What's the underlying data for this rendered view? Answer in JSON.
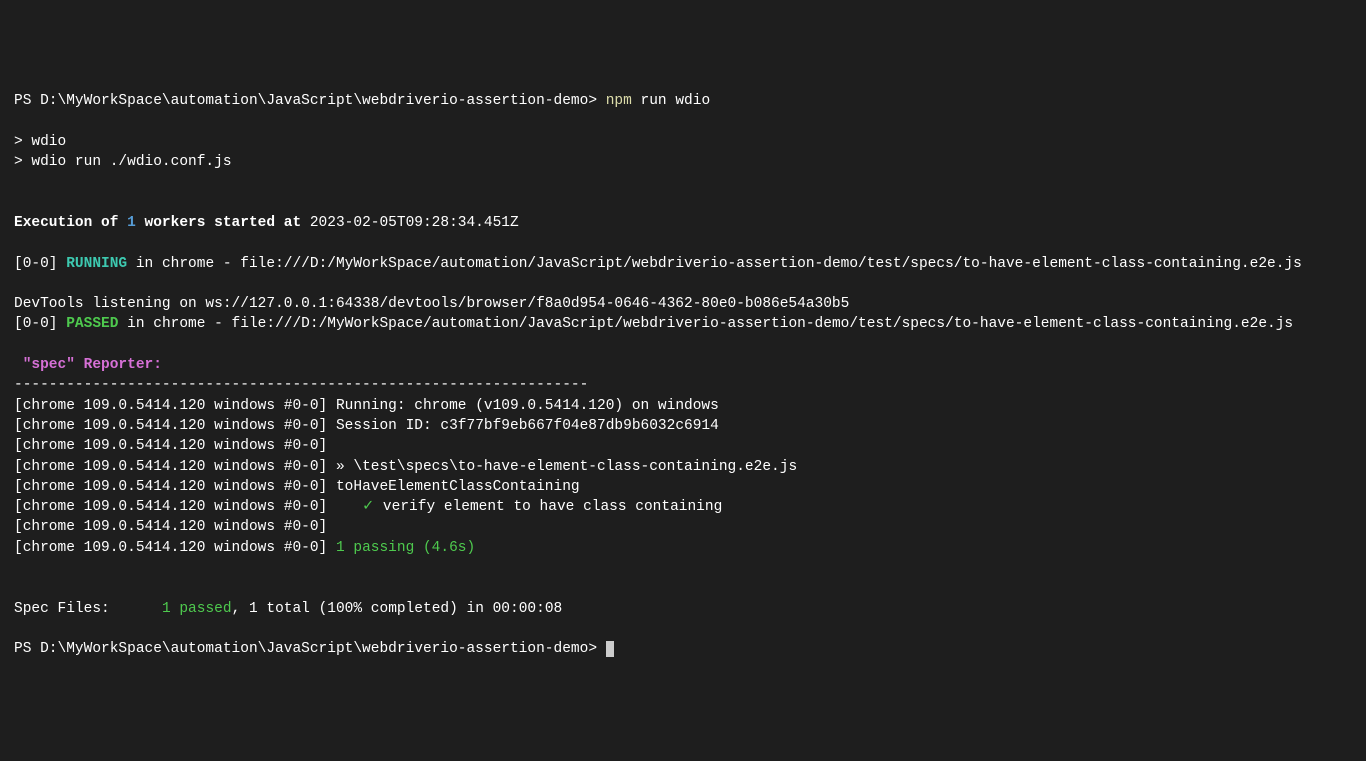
{
  "prompt": {
    "prefix": "PS ",
    "path": "D:\\MyWorkSpace\\automation\\JavaScript\\webdriverio-assertion-demo",
    "suffix": "> ",
    "command_npm": "npm",
    "command_rest": " run wdio"
  },
  "script_output": {
    "line1": "> wdio",
    "line2": "> wdio run ./wdio.conf.js"
  },
  "execution": {
    "prefix": "Execution of ",
    "workers": "1",
    "mid": " workers started at",
    "timestamp": " 2023-02-05T09:28:34.451Z"
  },
  "running": {
    "prefix": "[0-0] ",
    "status": "RUNNING",
    "suffix": " in chrome - file:///D:/MyWorkSpace/automation/JavaScript/webdriverio-assertion-demo/test/specs/to-have-element-class-containing.e2e.js"
  },
  "devtools": "DevTools listening on ws://127.0.0.1:64338/devtools/browser/f8a0d954-0646-4362-80e0-b086e54a30b5",
  "passed": {
    "prefix": "[0-0] ",
    "status": "PASSED",
    "suffix": " in chrome - file:///D:/MyWorkSpace/automation/JavaScript/webdriverio-assertion-demo/test/specs/to-have-element-class-containing.e2e.js"
  },
  "reporter": {
    "spec_quote": " \"spec\"",
    "reporter_label": " Reporter:"
  },
  "divider": "------------------------------------------------------------------",
  "chrome_prefix": "[chrome 109.0.5414.120 windows #0-0]",
  "lines": {
    "l1": " Running: chrome (v109.0.5414.120) on windows",
    "l2": " Session ID: c3f77bf9eb667f04e87db9b6032c6914",
    "l3": "",
    "l4": " » \\test\\specs\\to-have-element-class-containing.e2e.js",
    "l5": " toHaveElementClassContaining",
    "l6_check": "    ✓",
    "l6_text": " verify element to have class containing",
    "l7": "",
    "l8": " 1 passing (4.6s)"
  },
  "summary": {
    "label": "Spec Files:",
    "spacing": "      ",
    "passed": "1 passed",
    "rest": ", 1 total (100% completed) in 00:00:08"
  },
  "prompt2": {
    "prefix": "PS ",
    "path": "D:\\MyWorkSpace\\automation\\JavaScript\\webdriverio-assertion-demo",
    "suffix": "> "
  }
}
